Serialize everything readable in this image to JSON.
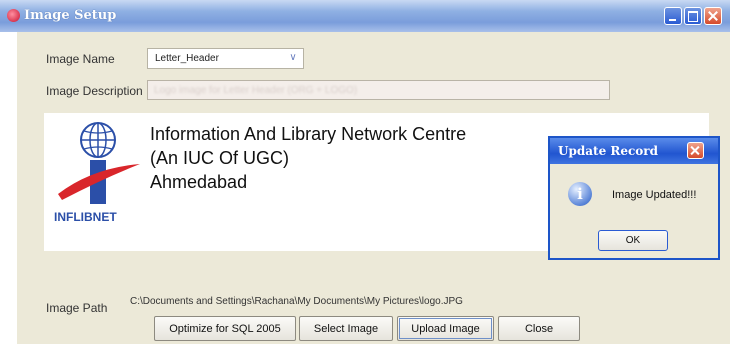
{
  "window": {
    "title": "Image Setup"
  },
  "form": {
    "image_name_label": "Image Name",
    "image_name_value": "Letter_Header",
    "image_description_label": "Image Description",
    "image_description_value": "Logo image for Letter Header (ORG + LOGO)",
    "image_path_label": "Image Path",
    "image_path_value": "C:\\Documents and Settings\\Rachana\\My Documents\\My Pictures\\logo.JPG"
  },
  "preview": {
    "logo_text": "INFLIBNET",
    "org_lines": [
      "Information And Library Network Centre",
      "(An IUC Of UGC)",
      "Ahmedabad"
    ]
  },
  "buttons": {
    "optimize": "Optimize for SQL 2005",
    "select": "Select Image",
    "upload": "Upload Image",
    "close": "Close"
  },
  "dialog": {
    "title": "Update Record",
    "message": "Image Updated!!!",
    "ok": "OK"
  },
  "icons": {
    "app": "app-icon",
    "minimize": "minimize-icon",
    "maximize": "maximize-icon",
    "close": "close-icon",
    "dropdown": "chevron-down-icon",
    "info": "info-icon"
  }
}
